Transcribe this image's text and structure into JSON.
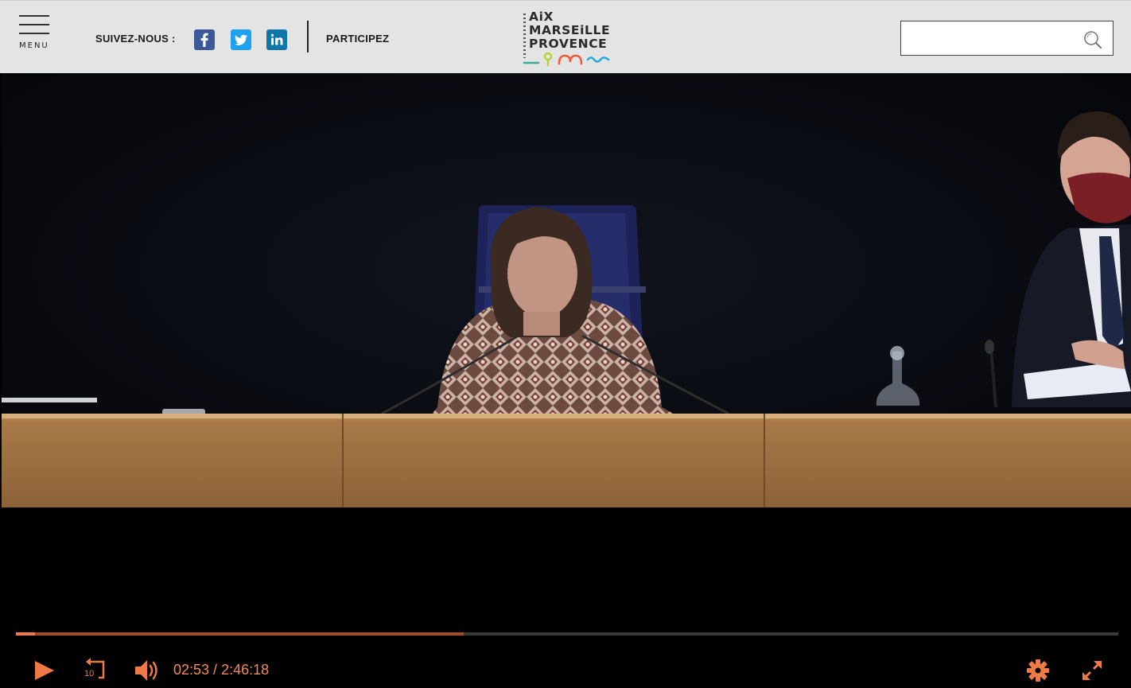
{
  "header": {
    "menu_label": "MENU",
    "follow_label": "SUIVEZ-NOUS :",
    "social": [
      "facebook-icon",
      "twitter-icon",
      "linkedin-icon"
    ],
    "participate_label": "PARTICIPEZ",
    "logo_lines": [
      "AiX",
      "MARSEiLLE",
      "PROVENCE"
    ],
    "search": {
      "value": "",
      "placeholder": ""
    }
  },
  "player": {
    "current_time": "02:53",
    "separator": " / ",
    "duration": "2:46:18",
    "played_fraction": 0.017,
    "buffered_fraction": 0.406,
    "skip_back_label": "10",
    "icons": [
      "play-icon",
      "replay-10-icon",
      "volume-icon",
      "settings-icon",
      "fullscreen-icon"
    ]
  },
  "colors": {
    "header_bg": "#e4e4e4",
    "accent": "#f07a45",
    "facebook": "#3b5998",
    "twitter": "#1da1f2",
    "linkedin": "#0e76a8"
  }
}
